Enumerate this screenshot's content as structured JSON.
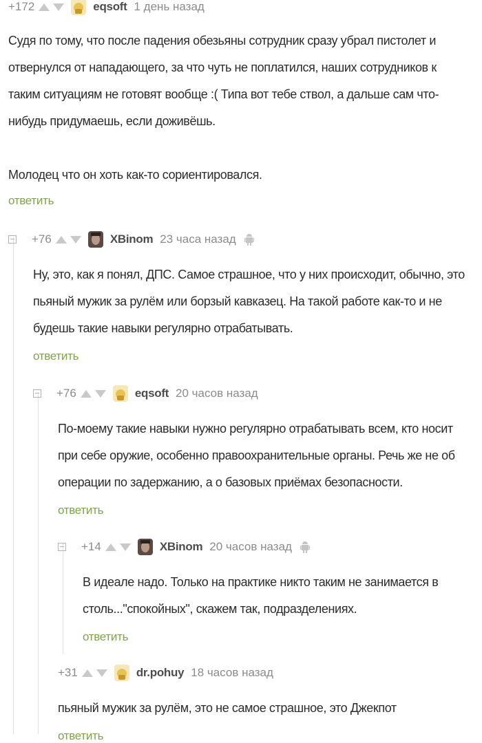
{
  "comments": [
    {
      "rating": "+172",
      "author": "eqsoft",
      "time": "1 день назад",
      "paragraphs": [
        "Судя по тому, что после падения обезьяны сотрудник сразу убрал пистолет и отвернулся от нападающего, за что чуть не поплатился, наших сотрудников к таким ситуациям не готовят вообще :( Типа вот тебе ствол, а дальше сам что-нибудь придумаешь, если доживёшь.",
        "Молодец что он хоть как-то сориентировался."
      ],
      "reply": "ответить"
    },
    {
      "rating": "+76",
      "author": "XBinom",
      "time": "23 часа назад",
      "text": "Ну, это, как я понял, ДПС. Самое страшное, что у них происходит, обычно, это пьяный мужик за рулём или борзый кавказец. На такой работе как-то и не будешь такие навыки регулярно отрабатывать.",
      "reply": "ответить"
    },
    {
      "rating": "+76",
      "author": "eqsoft",
      "time": "20 часов назад",
      "text": "По-моему такие навыки нужно регулярно отрабатывать всем, кто носит при себе оружие, особенно правоохранительные органы. Речь же не об операции по задержанию, а о базовых приёмах безопасности.",
      "reply": "ответить"
    },
    {
      "rating": "+14",
      "author": "XBinom",
      "time": "20 часов назад",
      "text": "В идеале надо. Только на практике никто таким не занимается в столь...\"спокойных\", скажем так, подразделениях.",
      "reply": "ответить"
    },
    {
      "rating": "+31",
      "author": "dr.pohuy",
      "time": "18 часов назад",
      "text": "пьяный мужик за рулём, это не самое страшное, это Джекпот",
      "reply": "ответить"
    }
  ],
  "colors": {
    "reply": "#7fa34d",
    "meta": "#8b8b8b",
    "vote": "#c9c9c9"
  },
  "icons": [
    "collapse-icon",
    "upvote-icon",
    "downvote-icon",
    "avatar",
    "android-icon"
  ]
}
